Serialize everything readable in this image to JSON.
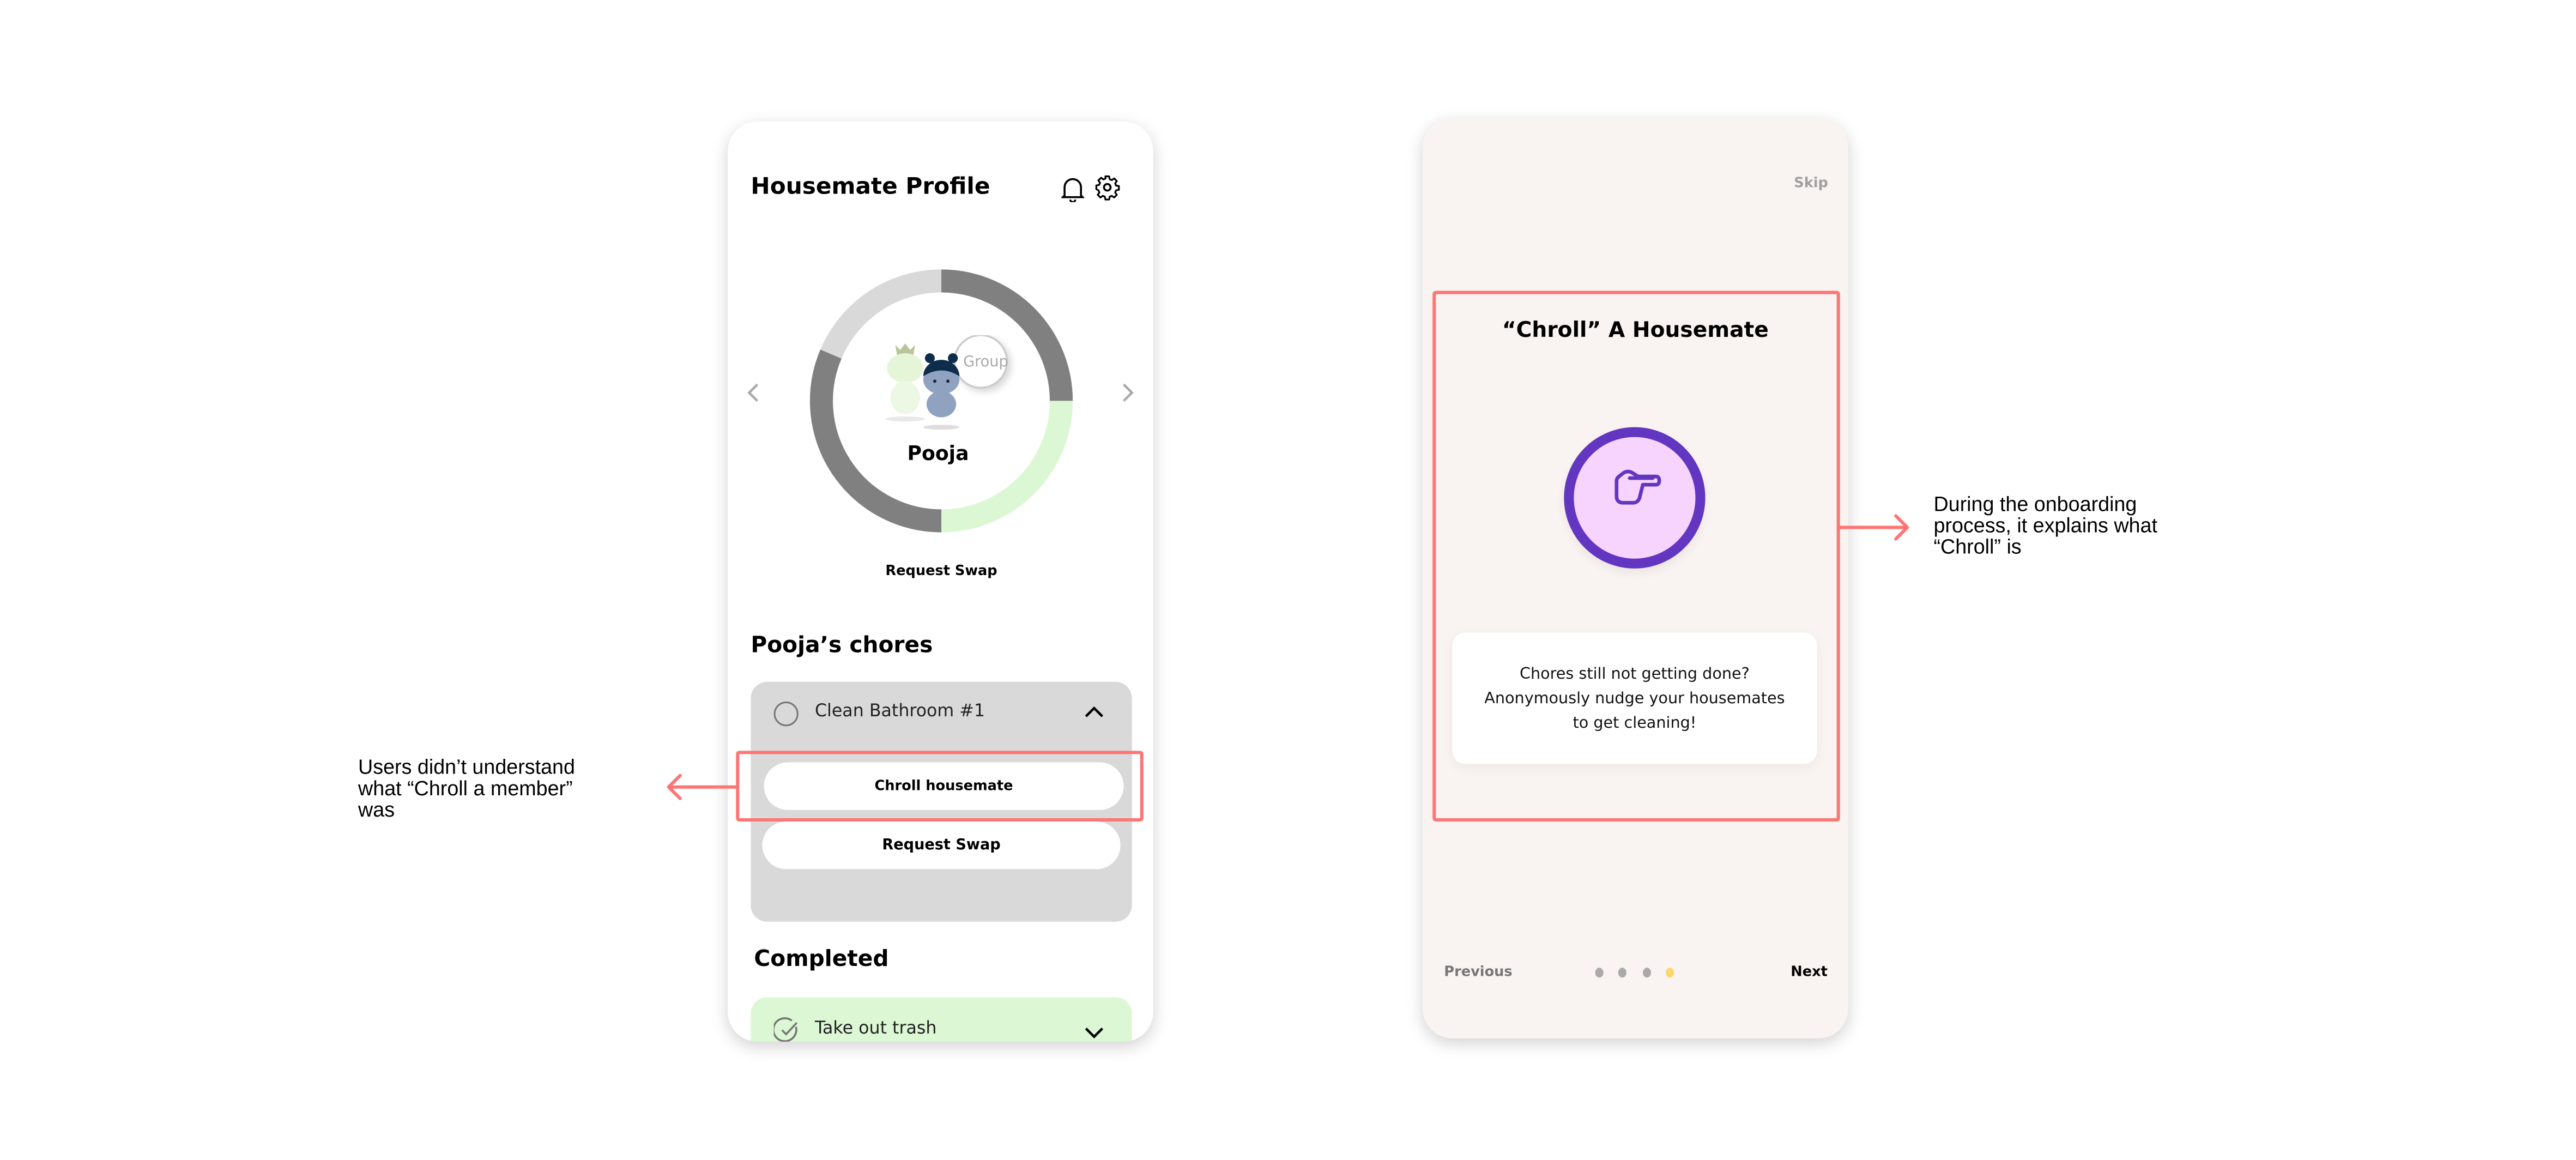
{
  "profile_screen": {
    "title": "Housemate Profile",
    "icons": [
      "bell-icon",
      "gear-icon"
    ],
    "member_name": "Pooja",
    "group_label": "Group",
    "ring_segments": [
      {
        "from_deg": 0,
        "to_deg": 90,
        "color": "#808080"
      },
      {
        "from_deg": 90,
        "to_deg": 180,
        "color": "#dcf7d4"
      },
      {
        "from_deg": 180,
        "to_deg": 293,
        "color": "#808080"
      },
      {
        "from_deg": 293,
        "to_deg": 360,
        "color": "#d9d9d9"
      }
    ],
    "request_swap_label": "Request Swap",
    "chores_heading": "Pooja’s chores",
    "chore": {
      "name": "Clean Bathroom #1",
      "chroll_button": "Chroll housemate",
      "swap_button": "Request Swap"
    },
    "completed_heading": "Completed",
    "completed_chore": {
      "name": "Take out trash"
    }
  },
  "onboarding_screen": {
    "skip": "Skip",
    "title": "“Chroll” A Housemate",
    "icon": "pointing-hand-icon",
    "description_lines": [
      "Chores still not getting done?",
      "Anonymously nudge your housemates",
      "to get cleaning!"
    ],
    "previous": "Previous",
    "next": "Next",
    "pages_total": 4,
    "current_page": 4
  },
  "annotations": {
    "left_lines": [
      "Users didn’t understand",
      "what “Chroll a member”",
      "was"
    ],
    "right_lines": [
      "During the onboarding",
      "process, it explains what",
      "“Chroll” is"
    ]
  },
  "colors": {
    "highlight": "#ff7474",
    "purple": "#6236c0",
    "pink": "#f7d4fe",
    "green": "#dcf7d4",
    "active_dot": "#ffd66b"
  }
}
